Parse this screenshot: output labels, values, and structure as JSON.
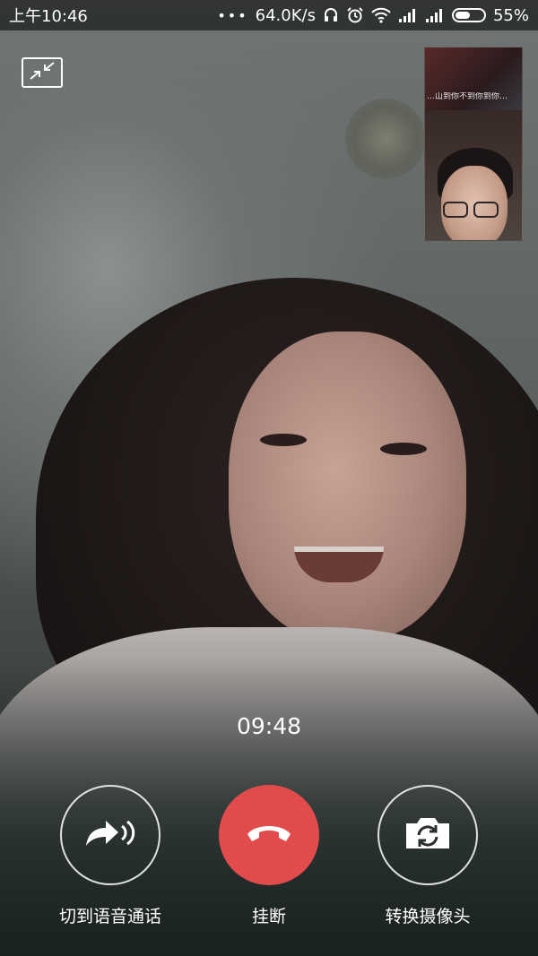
{
  "status_bar": {
    "time": "上午10:46",
    "more_dots": "•••",
    "network_speed": "64.0K/s",
    "battery_percent": "55%",
    "battery_level": 0.55,
    "icons": [
      "headset-icon",
      "alarm-icon",
      "wifi-icon",
      "signal-icon",
      "signal-icon-2",
      "battery-icon"
    ]
  },
  "call": {
    "timer": "09:48",
    "minimize_icon": "minimize-icon",
    "self_preview_caption": "…山到你不到你到你…"
  },
  "controls": {
    "switch_voice": {
      "label": "切到语音通话",
      "icon": "voice-switch-icon"
    },
    "hang_up": {
      "label": "挂断",
      "icon": "hang-up-icon",
      "color": "#e24b4b"
    },
    "switch_camera": {
      "label": "转换摄像头",
      "icon": "camera-switch-icon"
    }
  }
}
